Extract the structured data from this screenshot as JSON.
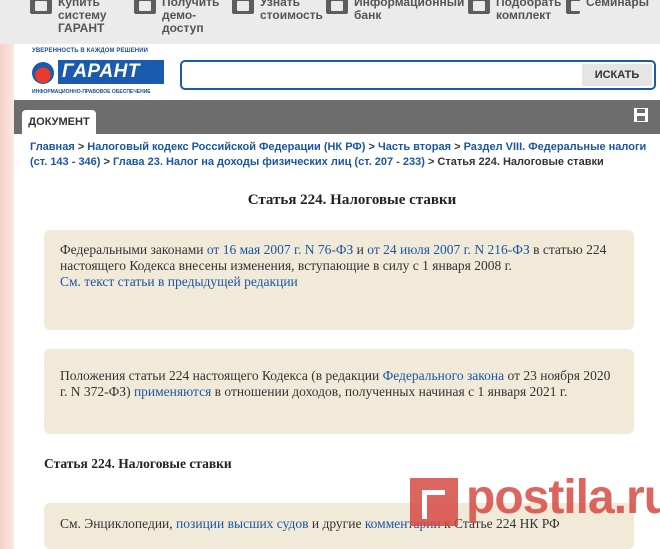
{
  "topnav": {
    "items": [
      {
        "label": "Купить\nсистему\nГАРАНТ",
        "icon": "cart-icon"
      },
      {
        "label": "Получить\nдемо-\nдоступ",
        "icon": "monitor-icon"
      },
      {
        "label": "Узнать\nстоимость",
        "icon": "calculator-icon"
      },
      {
        "label": "Информационный\nбанк",
        "icon": "database-icon"
      },
      {
        "label": "Подобрать\nкомплект",
        "icon": "package-icon"
      },
      {
        "label": "Семинары",
        "icon": "seminar-icon"
      }
    ]
  },
  "header": {
    "tagline": "УВЕРЕННОСТЬ В КАЖДОМ РЕШЕНИИ",
    "logo_text": "ГАРАНТ",
    "logo_sub": "ИНФОРМАЦИОННО-ПРАВОВОЕ ОБЕСПЕЧЕНИЕ",
    "search": {
      "value": "",
      "placeholder": "",
      "button": "ИСКАТЬ"
    }
  },
  "docbar": {
    "tab": "ДОКУМЕНТ",
    "save_icon": "save-icon"
  },
  "breadcrumb": [
    "Главная",
    "Налоговый кодекс Российской Федерации (НК РФ)",
    "Часть вторая",
    "Раздел VIII. Федеральные налоги (ст. 143 - 346)",
    "Глава 23. Налог на доходы физических лиц (ст. 207 - 233)",
    "Статья 224. Налоговые ставки"
  ],
  "article": {
    "title": "Статья 224. Налоговые ставки",
    "note1": {
      "t1": "Федеральными законами ",
      "link1": "от 16 мая 2007 г. N 76-ФЗ",
      "t2": " и ",
      "link2": "от 24 июля 2007 г. N 216-ФЗ",
      "t3": " в статью 224 настоящего Кодекса внесены изменения, вступающие в силу с 1 января 2008 г.",
      "link3": "См. текст статьи в предыдущей редакции"
    },
    "note2": {
      "t1": "Положения статьи 224 настоящего Кодекса (в редакции ",
      "link1": "Федерального закона",
      "t2": " от 23 ноября 2020 г. N 372-ФЗ) ",
      "link2": "применяются",
      "t3": " в отношении доходов, полученных начиная с 1 января 2021 г."
    },
    "subtitle": "Статья 224. Налоговые ставки",
    "note3": {
      "t1": "См. Энциклопедии, ",
      "link1": "позиции высших судов",
      "t2": " и другие ",
      "link2": "комментарии",
      "t3": " к Статье 224 НК РФ"
    }
  },
  "watermark": "postila.ru",
  "colors": {
    "brand_blue": "#1a5bb0",
    "link": "#1a56a4",
    "note_bg": "#f1ead8",
    "docbar": "#6d6d6d"
  }
}
